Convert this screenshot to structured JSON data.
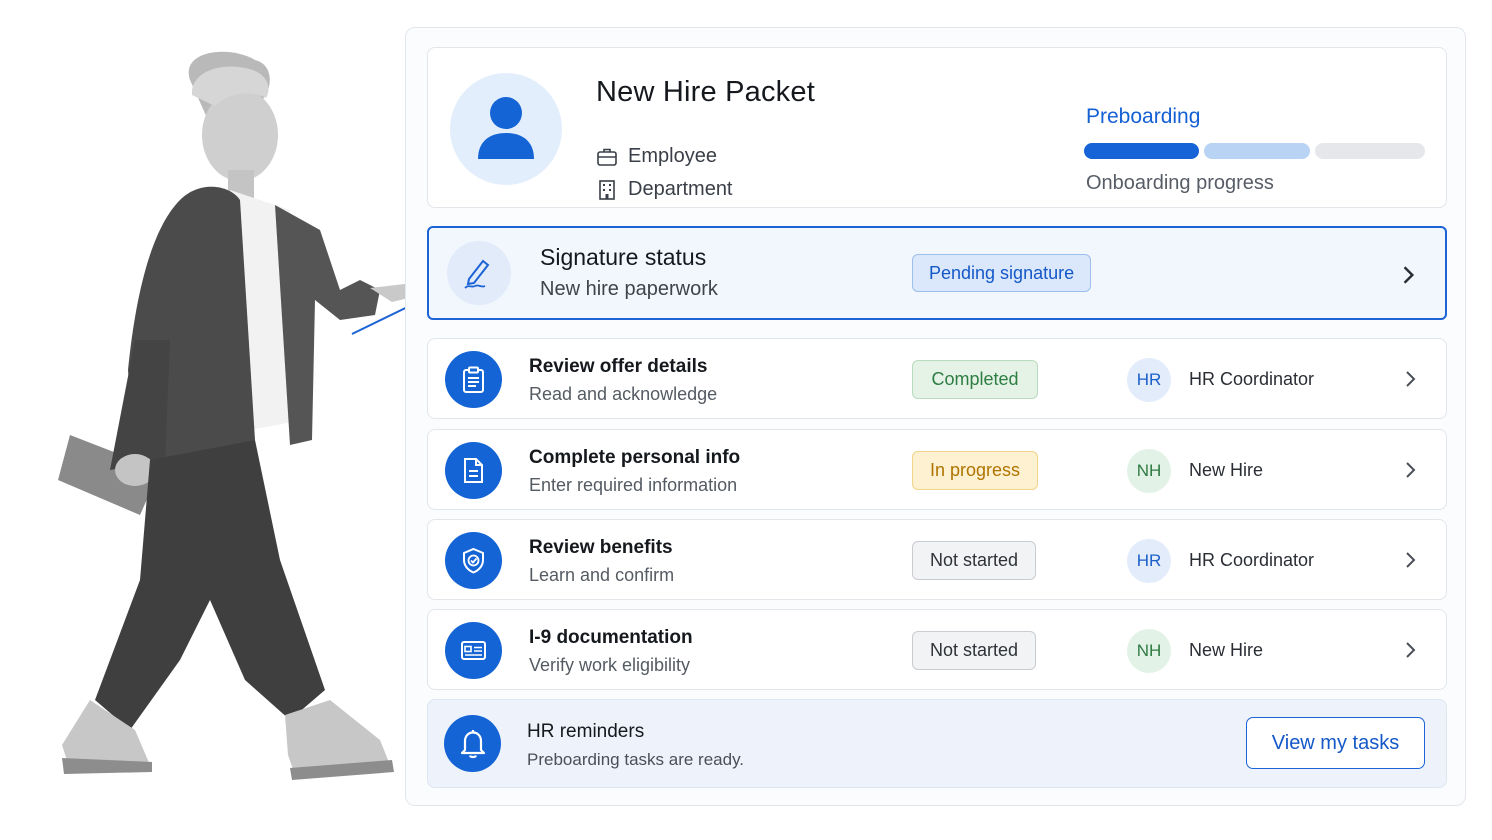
{
  "header": {
    "title": "New Hire Packet",
    "employee_label": "Employee",
    "department_label": "Department",
    "stage": "Preboarding",
    "progress_caption": "Onboarding progress",
    "progress_segments_complete": 1,
    "progress_segments_active": 1,
    "progress_segments_total": 3
  },
  "signature": {
    "title": "Signature status",
    "subtitle": "New hire paperwork",
    "status": "Pending signature"
  },
  "tasks": [
    {
      "title": "Review offer details",
      "subtitle": "Read and acknowledge",
      "status": "Completed",
      "assignee_initials": "HR",
      "assignee": "HR Coordinator",
      "icon": "clipboard-icon"
    },
    {
      "title": "Complete personal info",
      "subtitle": "Enter required information",
      "status": "In progress",
      "assignee_initials": "NH",
      "assignee": "New Hire",
      "icon": "document-icon"
    },
    {
      "title": "Review benefits",
      "subtitle": "Learn and confirm",
      "status": "Not started",
      "assignee_initials": "HR",
      "assignee": "HR Coordinator",
      "icon": "shield-check-icon"
    },
    {
      "title": "I-9 documentation",
      "subtitle": "Verify work eligibility",
      "status": "Not started",
      "assignee_initials": "NH",
      "assignee": "New Hire",
      "icon": "id-card-icon"
    }
  ],
  "reminders": {
    "title": "HR reminders",
    "subtitle": "Preboarding tasks are ready.",
    "button_label": "View my tasks",
    "icon": "bell-icon"
  },
  "colors": {
    "accent": "#1464d6",
    "completed": "#2e7d43",
    "in_progress": "#b07400",
    "not_started": "#2f3339"
  }
}
